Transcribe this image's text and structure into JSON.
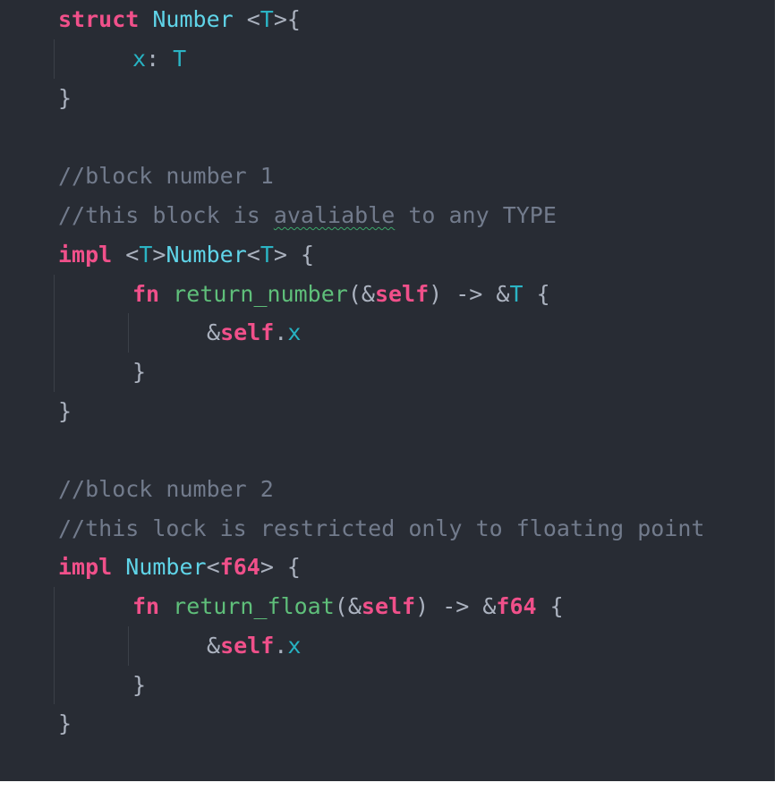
{
  "editor": {
    "background": "#282c34",
    "lines": {
      "l1": {
        "kw": "struct",
        "name": "Number",
        "lt": " <",
        "tp": "T",
        "rest": ">{"
      },
      "l2": {
        "field": "x",
        "colon": ": ",
        "type": "T"
      },
      "l3": {
        "text": "}"
      },
      "l4": {
        "text": ""
      },
      "l5": {
        "comment": "//block number 1"
      },
      "l6": {
        "c1": "//this block is ",
        "c2": "avaliable",
        "c3": " to any TYPE"
      },
      "l7": {
        "kw": "impl",
        "lt": " <",
        "tp": "T",
        "gt": ">",
        "name": "Number",
        "lt2": "<",
        "tp2": "T",
        "rest": "> {"
      },
      "l8": {
        "kw": "fn",
        "name": " return_number",
        "p1": "(&",
        "self": "self",
        "p2": ") -> &",
        "type": "T",
        "rest": " {"
      },
      "l9": {
        "amp": "&",
        "self": "self",
        "dot": ".",
        "field": "x"
      },
      "l10": {
        "text": "}"
      },
      "l11": {
        "text": "}"
      },
      "l12": {
        "text": ""
      },
      "l13": {
        "comment": "//block number 2"
      },
      "l14": {
        "comment": "//this lock is restricted only to floating point"
      },
      "l15": {
        "kw": "impl",
        "sp": " ",
        "name": "Number",
        "lt": "<",
        "type": "f64",
        "rest": "> {"
      },
      "l16": {
        "kw": "fn",
        "name": " return_float",
        "p1": "(&",
        "self": "self",
        "p2": ") -> &",
        "type": "f64",
        "rest": " {"
      },
      "l17": {
        "amp": "&",
        "self": "self",
        "dot": ".",
        "field": "x"
      },
      "l18": {
        "text": "}"
      },
      "l19": {
        "text": "}"
      }
    }
  },
  "colors": {
    "keyword": "#f0508a",
    "type": "#5fd4e8",
    "type_param": "#2bb4c4",
    "function": "#5fbf7a",
    "punctuation": "#abb2bf",
    "comment": "#727b8c",
    "squiggle": "#3ca86a"
  }
}
